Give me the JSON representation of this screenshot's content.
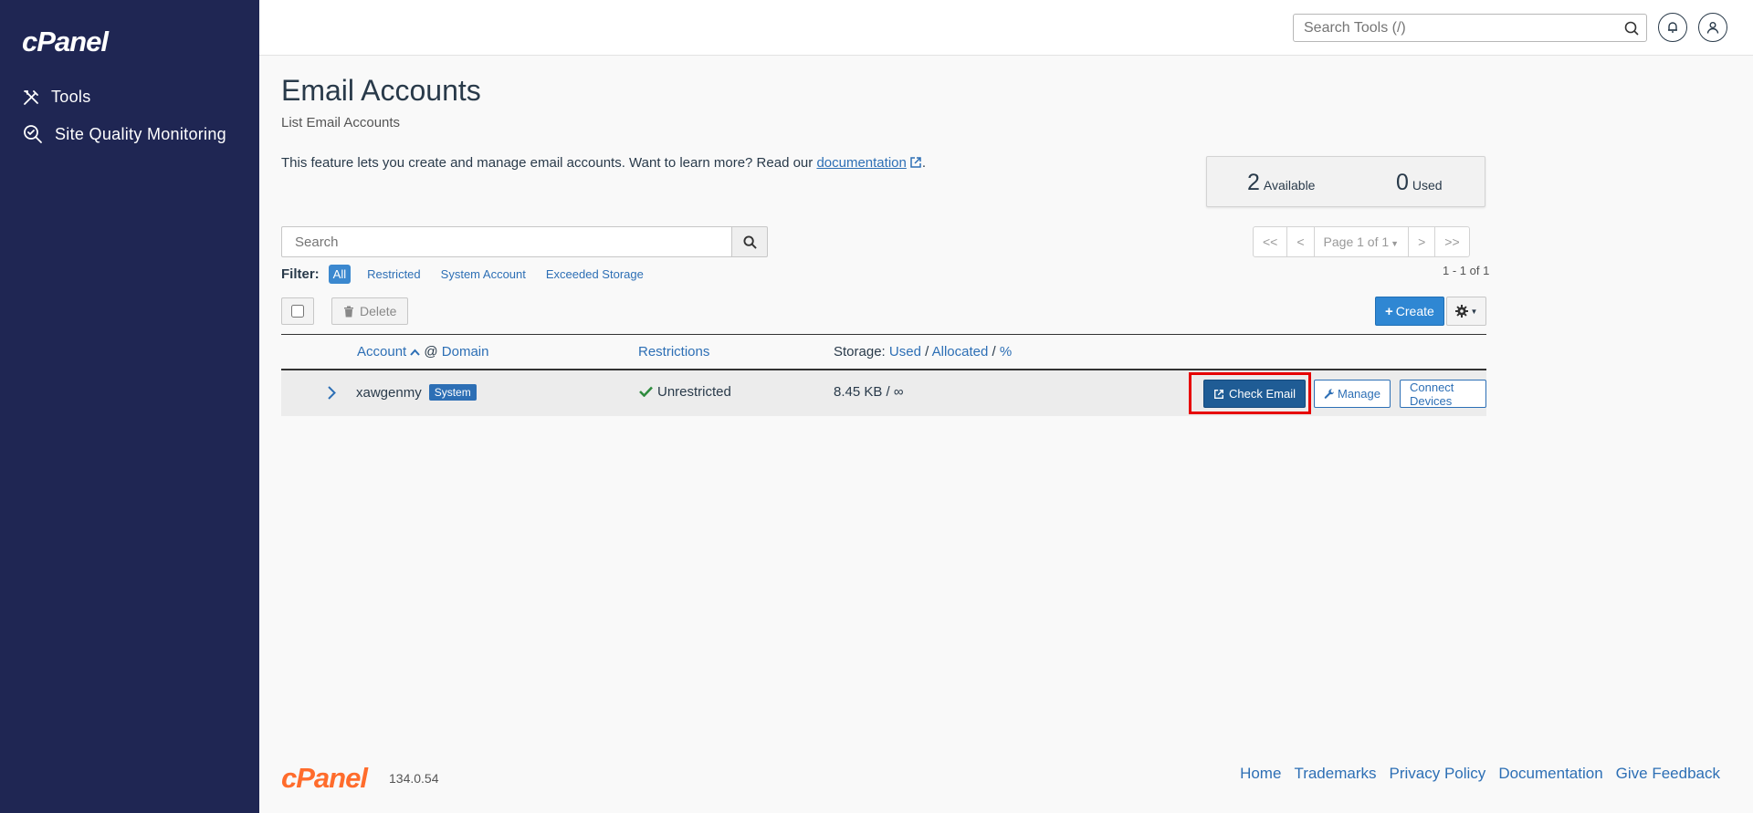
{
  "sidebar": {
    "logo": "cPanel",
    "items": [
      {
        "label": "Tools",
        "icon": "tools-icon"
      },
      {
        "label": "Site Quality Monitoring",
        "icon": "site-quality-icon"
      }
    ]
  },
  "topbar": {
    "search_placeholder": "Search Tools (/)"
  },
  "page": {
    "title": "Email Accounts",
    "subtitle": "List Email Accounts",
    "intro_text": "This feature lets you create and manage email accounts. Want to learn more? Read our",
    "intro_link": "documentation",
    "intro_end": "."
  },
  "stats": {
    "available_value": "2",
    "available_label": "Available",
    "used_value": "0",
    "used_label": "Used"
  },
  "search": {
    "placeholder": "Search"
  },
  "filter": {
    "label": "Filter:",
    "options": [
      "All",
      "Restricted",
      "System Account",
      "Exceeded Storage"
    ]
  },
  "pager": {
    "first": "<<",
    "prev": "<",
    "page": "Page 1 of 1",
    "next": ">",
    "last": ">>",
    "count": "1 - 1 of 1"
  },
  "toolbar": {
    "delete_label": "Delete",
    "create_label": "Create"
  },
  "table": {
    "headers": {
      "account": "Account",
      "at": "@",
      "domain": "Domain",
      "restrictions": "Restrictions",
      "storage": "Storage:",
      "used": "Used",
      "allocated": "Allocated",
      "percent": "%"
    },
    "rows": [
      {
        "account": "xawgenmy",
        "badge": "System",
        "restrictions": "Unrestricted",
        "storage": "8.45 KB / ∞",
        "check_email": "Check Email",
        "manage": "Manage",
        "connect": "Connect Devices"
      }
    ]
  },
  "footer": {
    "logo": "cPanel",
    "version": "134.0.54",
    "links": [
      "Home",
      "Trademarks",
      "Privacy Policy",
      "Documentation",
      "Give Feedback"
    ]
  },
  "colors": {
    "sidebar": "#1f2653",
    "link": "#2d6fb5",
    "highlight": "#e60000",
    "brand_orange": "#ff6c2c"
  }
}
